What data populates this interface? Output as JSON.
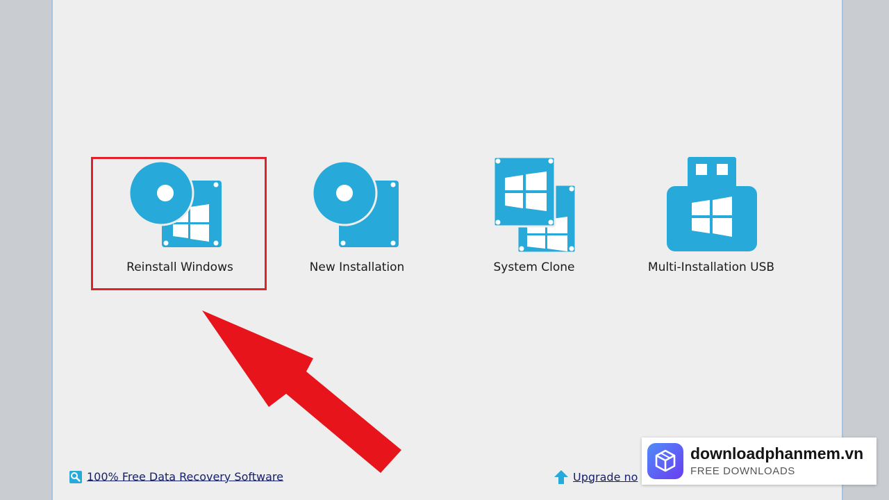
{
  "options": [
    {
      "label": "Reinstall Windows",
      "icon": "disc-windows-icon"
    },
    {
      "label": "New Installation",
      "icon": "disc-drive-icon"
    },
    {
      "label": "System Clone",
      "icon": "windows-clone-icon"
    },
    {
      "label": "Multi-Installation USB",
      "icon": "usb-windows-icon"
    }
  ],
  "footer": {
    "recovery_link": "100% Free Data Recovery Software",
    "upgrade_link": "Upgrade no"
  },
  "watermark": {
    "site": "downloadphanmem.vn",
    "subtitle": "FREE DOWNLOADS"
  },
  "colors": {
    "icon_blue": "#27a9d9",
    "highlight_red": "#e0202a",
    "window_bg": "#eeeeee"
  }
}
